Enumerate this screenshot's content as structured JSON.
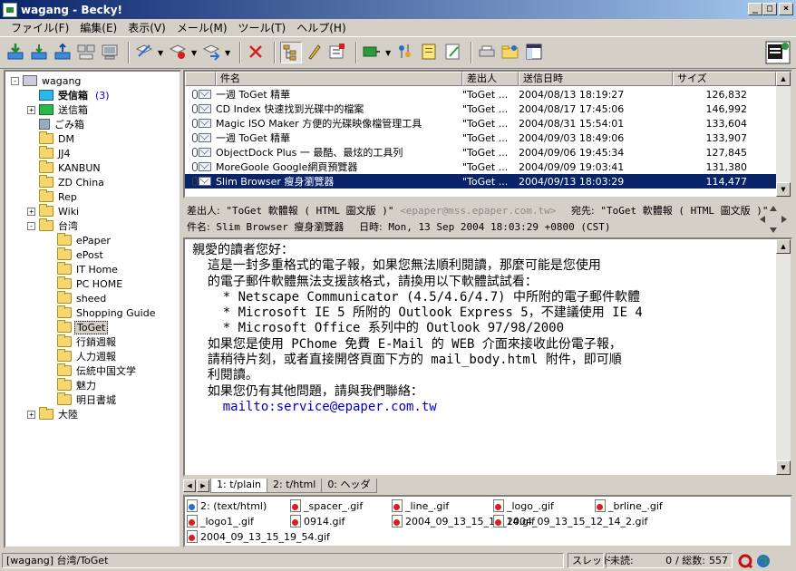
{
  "window": {
    "title": "wagang - Becky!"
  },
  "menu": [
    "ファイル(F)",
    "編集(E)",
    "表示(V)",
    "メール(M)",
    "ツール(T)",
    "ヘルプ(H)"
  ],
  "tree": [
    {
      "label": "wagang",
      "level": 0,
      "exp": "-",
      "icon": "computer-icon"
    },
    {
      "label": "受信箱",
      "level": 1,
      "count": "(3)",
      "bold": true,
      "icon": "inbox-icon"
    },
    {
      "label": "送信箱",
      "level": 1,
      "exp": "+",
      "icon": "outbox-icon"
    },
    {
      "label": "ごみ箱",
      "level": 1,
      "icon": "trash-icon"
    },
    {
      "label": "DM",
      "level": 1,
      "icon": "folder-icon"
    },
    {
      "label": "JJ4",
      "level": 1,
      "icon": "folder-icon"
    },
    {
      "label": "KANBUN",
      "level": 1,
      "icon": "folder-icon"
    },
    {
      "label": "ZD China",
      "level": 1,
      "icon": "folder-icon"
    },
    {
      "label": "Rep",
      "level": 1,
      "icon": "folder-icon"
    },
    {
      "label": "Wiki",
      "level": 1,
      "exp": "+",
      "icon": "folder-icon"
    },
    {
      "label": "台湾",
      "level": 1,
      "exp": "-",
      "icon": "folder-icon"
    },
    {
      "label": "ePaper",
      "level": 2,
      "icon": "folder-icon"
    },
    {
      "label": "ePost",
      "level": 2,
      "icon": "folder-icon"
    },
    {
      "label": "IT Home",
      "level": 2,
      "icon": "folder-icon"
    },
    {
      "label": "PC HOME",
      "level": 2,
      "icon": "folder-icon"
    },
    {
      "label": "sheed",
      "level": 2,
      "icon": "folder-icon"
    },
    {
      "label": "Shopping Guide",
      "level": 2,
      "icon": "folder-icon"
    },
    {
      "label": "ToGet",
      "level": 2,
      "selected": true,
      "icon": "folder-icon"
    },
    {
      "label": "行銷週報",
      "level": 2,
      "icon": "folder-icon"
    },
    {
      "label": "人力週報",
      "level": 2,
      "icon": "folder-icon"
    },
    {
      "label": "伝統中国文学",
      "level": 2,
      "icon": "folder-icon"
    },
    {
      "label": "魅力",
      "level": 2,
      "icon": "folder-icon"
    },
    {
      "label": "明日書城",
      "level": 2,
      "icon": "folder-icon"
    },
    {
      "label": "大陸",
      "level": 1,
      "exp": "+",
      "icon": "folder-icon"
    }
  ],
  "list": {
    "columns": [
      "件名",
      "差出人",
      "送信日時",
      "サイズ"
    ],
    "rows": [
      {
        "subject": "一週 ToGet 精華",
        "from": "\"ToGet ...",
        "date": "2004/08/13 18:19:27",
        "size": "126,832"
      },
      {
        "subject": "CD Index  快速找到光碟中的檔案",
        "from": "\"ToGet ...",
        "date": "2004/08/17 17:45:06",
        "size": "146,992"
      },
      {
        "subject": "Magic ISO Maker 方便的光碟映像檔管理工具",
        "from": "\"ToGet ...",
        "date": "2004/08/31 15:54:01",
        "size": "133,604"
      },
      {
        "subject": "一週 ToGet 精華",
        "from": "\"ToGet ...",
        "date": "2004/09/03 18:49:06",
        "size": "133,907"
      },
      {
        "subject": "ObjectDock Plus 一 最酷、最炫的工具列",
        "from": "\"ToGet ...",
        "date": "2004/09/06 19:45:34",
        "size": "127,845"
      },
      {
        "subject": "MoreGoole Google網頁預覽器",
        "from": "\"ToGet ...",
        "date": "2004/09/09 19:03:41",
        "size": "131,380"
      },
      {
        "subject": "Slim Browser 瘦身瀏覽器",
        "from": "\"ToGet ...",
        "date": "2004/09/13 18:03:29",
        "size": "114,477",
        "selected": true
      }
    ]
  },
  "header": {
    "from_key": "差出人:",
    "from_val": "\"ToGet 軟體報 ( HTML 圖文版 )\"",
    "from_addr": "<epaper@mss.epaper.com.tw>",
    "to_key": "宛先:",
    "to_val": "\"ToGet 軟體報 ( HTML 圖文版 )\"",
    "subj_key": "件名:",
    "subj_val": "Slim Browser 瘦身瀏覽器",
    "date_key": "日時:",
    "date_val": "Mon, 13 Sep 2004 18:03:29 +0800 (CST)"
  },
  "body": {
    "lines": [
      "親愛的讀者您好：",
      "",
      "  這是一封多重格式的電子報，如果您無法順利閱讀，那麼可能是您使用",
      "  的電子郵件軟體無法支援該格式，請換用以下軟體試試看：",
      "",
      "    * Netscape Communicator (4.5/4.6/4.7) 中所附的電子郵件軟體",
      "    * Microsoft IE 5 所附的 Outlook Express 5，不建議使用 IE 4",
      "    * Microsoft Office 系列中的 Outlook 97/98/2000",
      "",
      "  如果您是使用 PChome 免費 E-Mail 的 WEB 介面來接收此份電子報，",
      "  請稍待片刻，或者直接開啓頁面下方的 mail_body.html 附件，即可順",
      "  利閱讀。",
      "",
      "  如果您仍有其他問題，請與我們聯絡：",
      ""
    ],
    "link": "    mailto:service@epaper.com.tw"
  },
  "tabs": [
    "1: t/plain",
    "2: t/html",
    "0: ヘッダ"
  ],
  "attachments": [
    {
      "label": "2: (text/html)",
      "kind": "html"
    },
    {
      "label": "_spacer_.gif",
      "kind": "gif"
    },
    {
      "label": "_line_.gif",
      "kind": "gif"
    },
    {
      "label": "_logo_.gif",
      "kind": "gif"
    },
    {
      "label": "_brline_.gif",
      "kind": "gif"
    },
    {
      "label": "_logo1_.gif",
      "kind": "gif"
    },
    {
      "label": "0914.gif",
      "kind": "gif"
    },
    {
      "label": "2004_09_13_15_12_14.gif",
      "kind": "gif"
    },
    {
      "label": "2004_09_13_15_12_14_2.gif",
      "kind": "gif"
    },
    {
      "label": "2004_09_13_15_19_54.gif",
      "kind": "gif"
    }
  ],
  "status": {
    "path": "[wagang] 台湾/ToGet",
    "thread": "スレッド",
    "unread_label": "未読:",
    "unread": "0",
    "total_label": "/ 総数:",
    "total": "557"
  }
}
